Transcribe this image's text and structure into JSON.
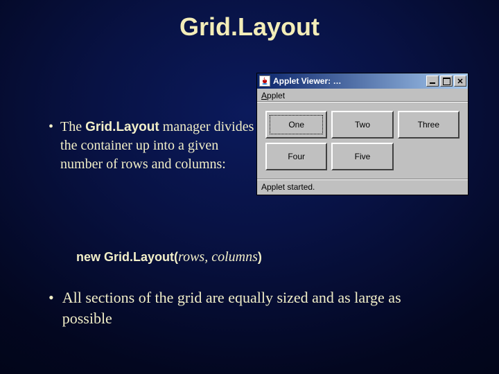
{
  "title": "Grid.Layout",
  "bullet1": {
    "prefix": "The ",
    "classname": "Grid.Layout",
    "rest": " manager divides the container up into a given number of rows and columns:"
  },
  "code": {
    "k_new": "new ",
    "classname": "Grid.Layout",
    "open": "(",
    "arg1": "rows",
    "sep": ", ",
    "arg2": "columns",
    "close": ")"
  },
  "bullet2": "All sections of the grid are equally sized and as large as possible",
  "applet": {
    "title": "Applet Viewer: …",
    "menu": {
      "first_letter": "A",
      "rest": "pplet"
    },
    "status": "Applet started.",
    "buttons": [
      "One",
      "Two",
      "Three",
      "Four",
      "Five"
    ]
  },
  "glyphs": {
    "bullet": "•",
    "close_x": "✕"
  }
}
